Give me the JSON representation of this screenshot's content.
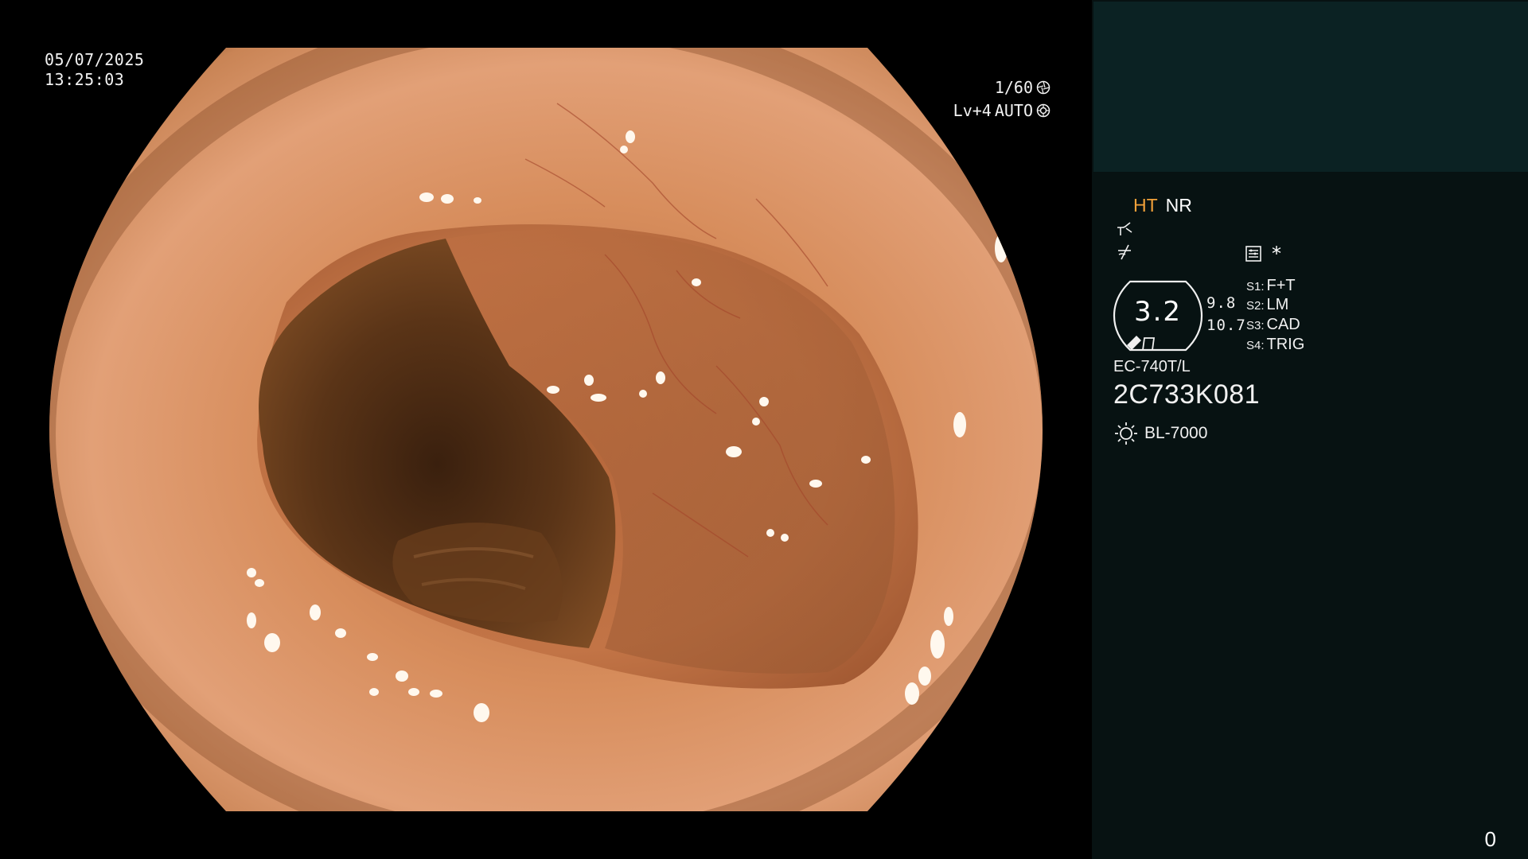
{
  "overlay": {
    "date": "05/07/2025",
    "time": "13:25:03",
    "shutter": "1/60",
    "shutter_icon": "shutter-icon",
    "iris_level": "Lv+4",
    "iris_mode": "AUTO",
    "iris_icon": "iris-icon"
  },
  "panel": {
    "mode_ht": "HT",
    "mode_nr": "NR",
    "enhance_icons": [
      "enhancement-curve-icon",
      "color-enhance-icon"
    ],
    "memo_icon": "memo-icon",
    "star": "*",
    "zoom": "3.2",
    "readout_1": "9.8",
    "readout_2": "10.7",
    "switches": [
      {
        "key": "S1:",
        "value": "F+T"
      },
      {
        "key": "S2:",
        "value": "LM"
      },
      {
        "key": "S3:",
        "value": "CAD"
      },
      {
        "key": "S4:",
        "value": "TRIG"
      }
    ],
    "scope_model": "EC-740T/L",
    "scope_serial": "2C733K081",
    "light_icon": "sun-icon",
    "light_source": "BL-7000",
    "frame_counter": "0"
  },
  "colors": {
    "background": "#000000",
    "panel_background": "#071212",
    "thumbnail_background": "#0b2223",
    "ht_orange": "#f2a13a",
    "text": "#f0f0f0"
  }
}
